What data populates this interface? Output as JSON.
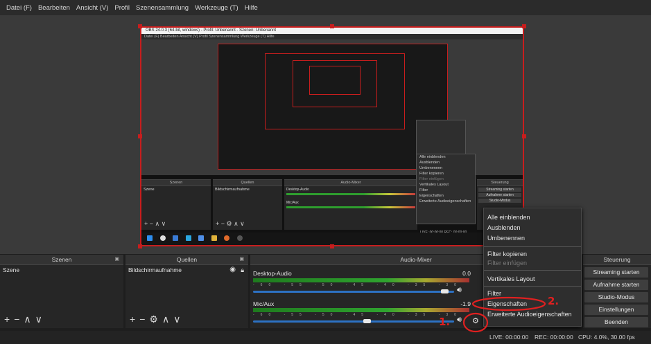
{
  "menubar": [
    "Datei (F)",
    "Bearbeiten",
    "Ansicht (V)",
    "Profil",
    "Szenensammlung",
    "Werkzeuge (T)",
    "Hilfe"
  ],
  "mini": {
    "title": "OBS 24.0.3 (64-bit, windows) - Profil: Unbenannt - Szenen: Unbenannt",
    "menu": "Datei (F)   Bearbeiten   Ansicht (V)   Profil   Szenensammlung   Werkzeuge (T)   Hilfe",
    "docks": [
      "Szenen",
      "Quellen",
      "Audio-Mixer",
      "Steuerung"
    ],
    "scene": "Szene",
    "source": "Bildschirmaufnahme",
    "tracks": [
      {
        "name": "Desktop-Audio",
        "db": "0.0"
      },
      {
        "name": "Mic/Aux",
        "db": "-11.8"
      }
    ],
    "controls": [
      "Streaming starten",
      "Aufnahme starten",
      "Studio-Modus"
    ],
    "ctx": [
      "Alle einblenden",
      "Ausblenden",
      "Umbenennen",
      "Filter kopieren",
      "Filter einfügen",
      "Vertikales Layout",
      "Filter",
      "Eigenschaften",
      "Erweiterte Audioeigenschaften"
    ],
    "status": "LIVE: 00:00:00    REC: 00:00:00"
  },
  "docks": {
    "scenes": {
      "title": "Szenen",
      "items": [
        "Szene"
      ]
    },
    "sources": {
      "title": "Quellen",
      "items": [
        "Bildschirmaufnahme"
      ]
    },
    "mixer": {
      "title": "Audio-Mixer",
      "tracks": [
        {
          "name": "Desktop-Audio",
          "db": "0.0",
          "volume": 0.97
        },
        {
          "name": "Mic/Aux",
          "db": "-1.9",
          "volume": 0.57
        }
      ],
      "scale": "-60 -55 -50 -45 -40 -35 -30 -25 -20 -15 -10 -5 0"
    },
    "controls": {
      "title": "Steuerung",
      "buttons": [
        "Streaming starten",
        "Aufnahme starten",
        "Studio-Modus",
        "Einstellungen",
        "Beenden"
      ]
    }
  },
  "context_menu": {
    "groups": [
      [
        "Alle einblenden",
        "Ausblenden",
        "Umbenennen"
      ],
      [
        "Filter kopieren",
        "Filter einfügen"
      ],
      [
        "Vertikales Layout"
      ],
      [
        "Filter",
        "Eigenschaften",
        "Erweiterte Audioeigenschaften"
      ]
    ],
    "disabled": [
      "Filter einfügen"
    ]
  },
  "statusbar": {
    "live": "LIVE: 00:00:00",
    "rec": "REC: 00:00:00",
    "cpu": "CPU: 4.0%, 30.00 fps"
  },
  "annotations": {
    "step1": "1.",
    "step2": "2.",
    "color": "#e02020"
  },
  "colors": {
    "accent_red": "#c81d1d",
    "slider_blue": "#2d72c4",
    "panel": "#262626"
  }
}
